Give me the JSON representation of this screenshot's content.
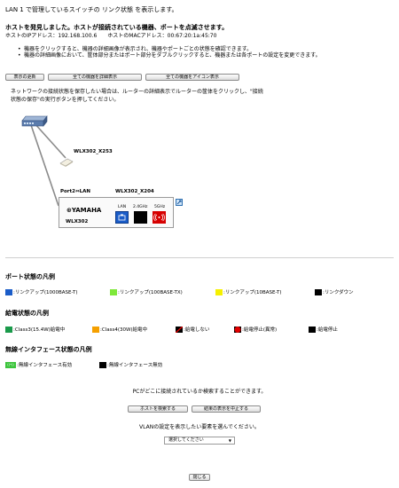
{
  "title": "LAN 1 で管理しているスイッチの リンク状態 を表示します。",
  "host_found": "ホストを発見しました。ホストが接続されている機器、ポートを点滅させます。",
  "host_info": "ホストのIPアドレス：192.168.100.6　　ホストのMACアドレス：00:67:20:1a:45:70",
  "instructions": [
    "機器をクリックすると、機器の詳細画像が表示され、機器やポートごとの状態を確認できます。",
    "機器の詳細画像において、筐体部分またはポート部分をダブルクリックすると、機器または各ポートの設定を変更できます。"
  ],
  "buttons": {
    "refresh": "表示の更新",
    "show_all_detail": "全ての機器を詳細表示",
    "show_all_icon": "全ての機器をアイコン表示",
    "search_host": "ホストを検索する",
    "stop_display": "結果の表示を中止する",
    "close": "閉じる"
  },
  "network_notice": "ネットワークの接続状態を保存したい場合は、ルーターの詳細表示でルーターの筐体をクリックし、\"接続状態の保存\"の実行ボタンを押してください。",
  "topology": {
    "ap1_name": "WLX302_X253",
    "port_label": "Port2⇔LAN",
    "ap2_name": "WLX302_X204",
    "device_logo": "⊛YAMAHA",
    "device_model": "WLX302",
    "port_labels": [
      "LAN",
      "2.4GHz",
      "5GHz"
    ]
  },
  "legend_port": {
    "title": "ポート状態の凡例",
    "items": [
      {
        "label": ":リンクアップ(1000BASE-T)",
        "color": "#1a5cc8"
      },
      {
        "label": ":リンクアップ(100BASE-TX)",
        "color": "#7ee83a"
      },
      {
        "label": ":リンクアップ(10BASE-T)",
        "color": "#f5f000"
      },
      {
        "label": ":リンクダウン",
        "color": "#000000"
      }
    ]
  },
  "legend_power": {
    "title": "給電状態の凡例",
    "items": [
      {
        "label": ":Class3(15.4W)給電中",
        "color": "#1a9a4a"
      },
      {
        "label": ":Class4(30W)給電中",
        "color": "#f5a000"
      },
      {
        "label": ":給電しない",
        "color": "#000000"
      },
      {
        "label": ":給電停止(異常)",
        "color": "#e00000"
      },
      {
        "label": ":給電停止",
        "color": "#000000"
      }
    ]
  },
  "legend_wireless": {
    "title": "無線インタフェース状態の凡例",
    "items": [
      {
        "label": ":無線インタフェース有効",
        "color": "#3cc43c",
        "badge": "((•))"
      },
      {
        "label": ":無線インタフェース無効",
        "color": "#000000"
      }
    ]
  },
  "pc_search_text": "PCがどこに接続されているか検索することができます。",
  "vlan_text": "VLANの設定を表示したい要素を選んでください。",
  "vlan_select": "選択してください"
}
